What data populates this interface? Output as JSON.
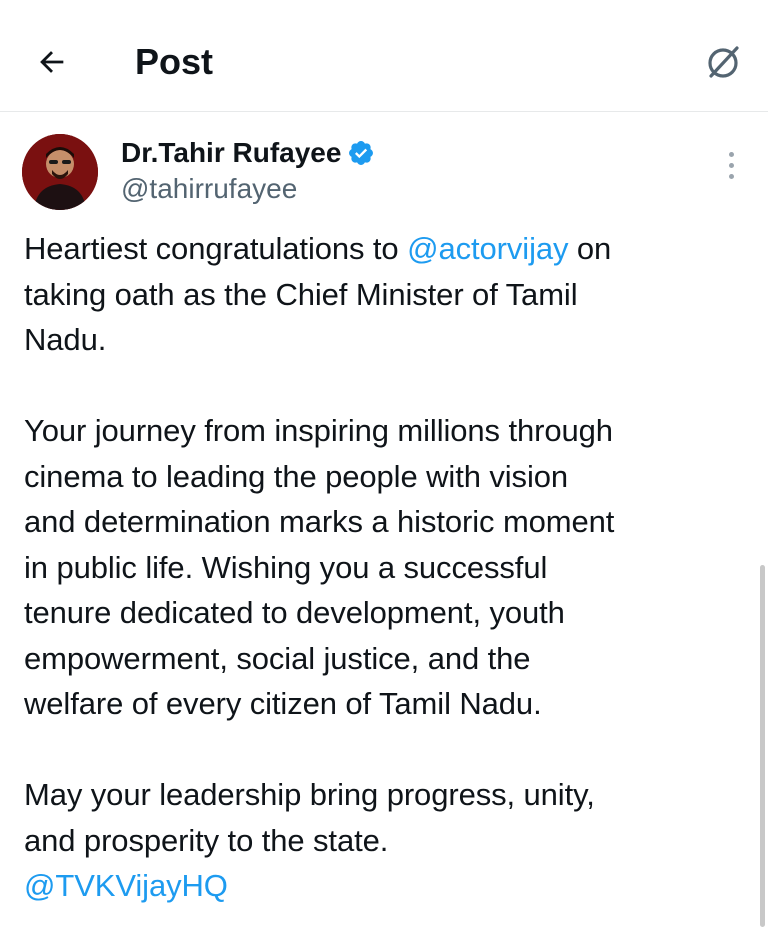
{
  "header": {
    "title": "Post"
  },
  "author": {
    "name": "Dr.Tahir Rufayee",
    "handle": "@tahirrufayee"
  },
  "tweet": {
    "l1_pre": "Heartiest congratulations to ",
    "l1_mention": "@actorvijay",
    "l1_post": " on",
    "l2": "taking oath as the Chief Minister of Tamil",
    "l3": "Nadu.",
    "l5": "Your journey from inspiring millions through",
    "l6": "cinema to leading the people with vision",
    "l7": "and determination marks a historic moment",
    "l8": "in public life. Wishing you a successful",
    "l9": "tenure dedicated to development, youth",
    "l10": "empowerment, social justice, and the",
    "l11": "welfare of every citizen of Tamil Nadu.",
    "l13": "May your leadership bring progress, unity,",
    "l14": "and prosperity to the state.",
    "l15_mention": "@TVKVijayHQ"
  },
  "icons": {
    "back": "arrow-left-icon",
    "grok": "grok-icon",
    "verified": "verified-badge-icon",
    "more": "more-vertical-icon"
  },
  "colors": {
    "accent": "#1d9bf0",
    "text": "#0f1419",
    "secondary": "#536471"
  }
}
